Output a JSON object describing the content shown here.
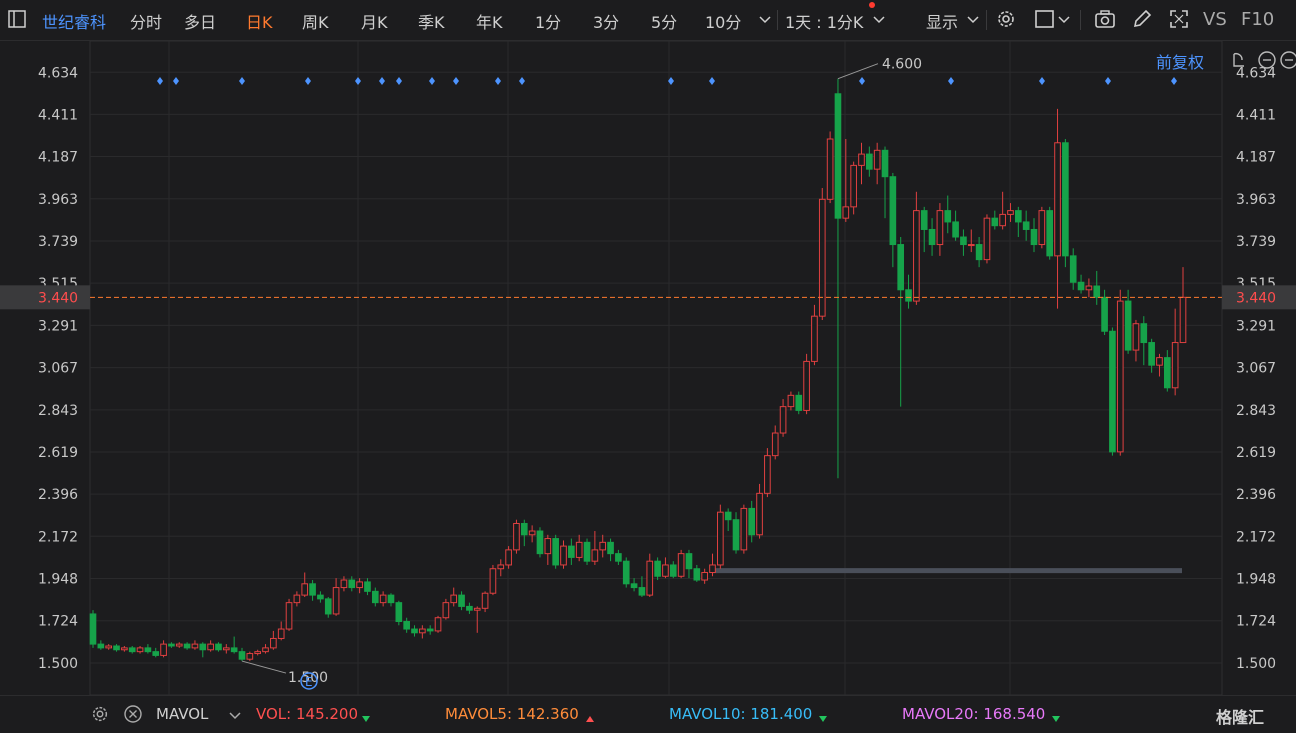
{
  "toolbar": {
    "stock_name": "世纪睿科",
    "tabs": [
      "分时",
      "多日",
      "日K",
      "周K",
      "月K",
      "季K",
      "年K",
      "1分",
      "3分",
      "5分",
      "10分"
    ],
    "active_tab": "日K",
    "interval_select": "1天 : 1分K",
    "display_label": "显示",
    "vs_label": "VS",
    "f10_label": "F10"
  },
  "adjust_label": "前复权",
  "watermark": "格隆汇",
  "bottom": {
    "indicator": "MAVOL",
    "vol": "VOL: 145.200",
    "mavol5": "MAVOL5: 142.360",
    "mavol10": "MAVOL10: 181.400",
    "mavol20": "MAVOL20: 168.540"
  },
  "colors": {
    "up": "#e04040",
    "down": "#16a34a",
    "accent": "#ff7a2f",
    "link": "#4d94ff"
  },
  "chart_data": {
    "type": "candlestick",
    "y_ticks": [
      "4.634",
      "4.411",
      "4.187",
      "3.963",
      "3.739",
      "3.515",
      "3.291",
      "3.067",
      "2.843",
      "2.619",
      "2.396",
      "2.172",
      "1.948",
      "1.724",
      "1.500"
    ],
    "ylim": [
      1.33,
      4.8
    ],
    "current_price": "3.440",
    "high_label": "4.600",
    "low_label": "1.500",
    "event_marker": "E",
    "candles": [
      [
        1.76,
        1.6,
        1.78,
        1.58
      ],
      [
        1.6,
        1.58,
        1.62,
        1.57
      ],
      [
        1.58,
        1.59,
        1.6,
        1.57
      ],
      [
        1.59,
        1.57,
        1.6,
        1.56
      ],
      [
        1.57,
        1.58,
        1.59,
        1.56
      ],
      [
        1.58,
        1.56,
        1.59,
        1.55
      ],
      [
        1.56,
        1.58,
        1.59,
        1.55
      ],
      [
        1.58,
        1.56,
        1.6,
        1.55
      ],
      [
        1.56,
        1.54,
        1.58,
        1.53
      ],
      [
        1.54,
        1.6,
        1.62,
        1.53
      ],
      [
        1.6,
        1.59,
        1.61,
        1.58
      ],
      [
        1.59,
        1.6,
        1.61,
        1.58
      ],
      [
        1.6,
        1.58,
        1.61,
        1.57
      ],
      [
        1.58,
        1.6,
        1.62,
        1.57
      ],
      [
        1.6,
        1.57,
        1.61,
        1.53
      ],
      [
        1.57,
        1.6,
        1.62,
        1.56
      ],
      [
        1.6,
        1.57,
        1.61,
        1.56
      ],
      [
        1.57,
        1.58,
        1.6,
        1.55
      ],
      [
        1.58,
        1.56,
        1.64,
        1.55
      ],
      [
        1.56,
        1.52,
        1.58,
        1.51
      ],
      [
        1.52,
        1.55,
        1.56,
        1.51
      ],
      [
        1.55,
        1.56,
        1.57,
        1.54
      ],
      [
        1.56,
        1.58,
        1.6,
        1.55
      ],
      [
        1.58,
        1.63,
        1.67,
        1.57
      ],
      [
        1.63,
        1.68,
        1.72,
        1.62
      ],
      [
        1.68,
        1.82,
        1.84,
        1.67
      ],
      [
        1.82,
        1.86,
        1.88,
        1.8
      ],
      [
        1.86,
        1.92,
        1.98,
        1.85
      ],
      [
        1.92,
        1.86,
        1.94,
        1.83
      ],
      [
        1.86,
        1.84,
        1.88,
        1.82
      ],
      [
        1.84,
        1.76,
        1.85,
        1.74
      ],
      [
        1.76,
        1.9,
        1.95,
        1.75
      ],
      [
        1.9,
        1.94,
        1.96,
        1.88
      ],
      [
        1.94,
        1.9,
        1.96,
        1.88
      ],
      [
        1.9,
        1.93,
        1.95,
        1.87
      ],
      [
        1.93,
        1.88,
        1.95,
        1.86
      ],
      [
        1.88,
        1.82,
        1.9,
        1.8
      ],
      [
        1.82,
        1.86,
        1.88,
        1.8
      ],
      [
        1.86,
        1.82,
        1.87,
        1.8
      ],
      [
        1.82,
        1.72,
        1.83,
        1.7
      ],
      [
        1.72,
        1.68,
        1.74,
        1.66
      ],
      [
        1.68,
        1.66,
        1.7,
        1.64
      ],
      [
        1.66,
        1.68,
        1.7,
        1.63
      ],
      [
        1.68,
        1.67,
        1.7,
        1.65
      ],
      [
        1.67,
        1.74,
        1.75,
        1.66
      ],
      [
        1.74,
        1.82,
        1.84,
        1.73
      ],
      [
        1.82,
        1.86,
        1.9,
        1.8
      ],
      [
        1.86,
        1.8,
        1.88,
        1.78
      ],
      [
        1.8,
        1.78,
        1.82,
        1.76
      ],
      [
        1.78,
        1.79,
        1.8,
        1.66
      ],
      [
        1.79,
        1.87,
        1.88,
        1.77
      ],
      [
        1.87,
        2.0,
        2.02,
        1.86
      ],
      [
        2.0,
        2.02,
        2.05,
        1.96
      ],
      [
        2.02,
        2.1,
        2.12,
        2.0
      ],
      [
        2.1,
        2.24,
        2.26,
        2.08
      ],
      [
        2.24,
        2.18,
        2.26,
        2.12
      ],
      [
        2.18,
        2.2,
        2.23,
        2.14
      ],
      [
        2.2,
        2.08,
        2.22,
        2.06
      ],
      [
        2.08,
        2.16,
        2.18,
        2.02
      ],
      [
        2.16,
        2.02,
        2.18,
        2.0
      ],
      [
        2.02,
        2.12,
        2.15,
        2.0
      ],
      [
        2.12,
        2.06,
        2.16,
        2.02
      ],
      [
        2.06,
        2.14,
        2.18,
        2.04
      ],
      [
        2.14,
        2.04,
        2.16,
        2.02
      ],
      [
        2.04,
        2.1,
        2.2,
        2.02
      ],
      [
        2.1,
        2.14,
        2.18,
        2.06
      ],
      [
        2.14,
        2.08,
        2.16,
        2.04
      ],
      [
        2.08,
        2.04,
        2.1,
        2.02
      ],
      [
        2.04,
        1.92,
        2.06,
        1.9
      ],
      [
        1.92,
        1.9,
        1.95,
        1.88
      ],
      [
        1.9,
        1.86,
        1.96,
        1.85
      ],
      [
        1.86,
        2.04,
        2.08,
        1.85
      ],
      [
        2.04,
        1.96,
        2.06,
        1.94
      ],
      [
        1.96,
        2.02,
        2.06,
        1.95
      ],
      [
        2.02,
        1.96,
        2.04,
        1.95
      ],
      [
        1.96,
        2.08,
        2.1,
        1.95
      ],
      [
        2.08,
        2.0,
        2.1,
        1.95
      ],
      [
        2.0,
        1.94,
        2.02,
        1.93
      ],
      [
        1.94,
        1.98,
        2.0,
        1.92
      ],
      [
        1.98,
        2.02,
        2.08,
        1.96
      ],
      [
        2.02,
        2.3,
        2.34,
        2.0
      ],
      [
        2.3,
        2.26,
        2.32,
        2.2
      ],
      [
        2.26,
        2.1,
        2.3,
        2.08
      ],
      [
        2.1,
        2.32,
        2.34,
        2.08
      ],
      [
        2.32,
        2.18,
        2.36,
        2.14
      ],
      [
        2.18,
        2.4,
        2.45,
        2.16
      ],
      [
        2.4,
        2.6,
        2.64,
        2.38
      ],
      [
        2.6,
        2.72,
        2.76,
        2.58
      ],
      [
        2.72,
        2.86,
        2.9,
        2.7
      ],
      [
        2.86,
        2.92,
        2.94,
        2.84
      ],
      [
        2.92,
        2.84,
        2.94,
        2.82
      ],
      [
        2.84,
        3.1,
        3.14,
        2.82
      ],
      [
        3.1,
        3.34,
        3.4,
        3.08
      ],
      [
        3.34,
        3.96,
        4.02,
        3.32
      ],
      [
        3.96,
        4.28,
        4.32,
        3.94
      ],
      [
        4.52,
        3.86,
        4.6,
        2.48
      ],
      [
        3.86,
        3.92,
        4.28,
        3.84
      ],
      [
        3.92,
        4.14,
        4.16,
        3.88
      ],
      [
        4.14,
        4.2,
        4.26,
        4.04
      ],
      [
        4.2,
        4.12,
        4.24,
        4.08
      ],
      [
        4.12,
        4.22,
        4.26,
        4.04
      ],
      [
        4.22,
        4.08,
        4.24,
        3.86
      ],
      [
        4.08,
        3.72,
        4.1,
        3.6
      ],
      [
        3.72,
        3.48,
        3.76,
        2.86
      ],
      [
        3.48,
        3.42,
        3.56,
        3.38
      ],
      [
        3.42,
        3.9,
        4.0,
        3.4
      ],
      [
        3.9,
        3.8,
        3.92,
        3.68
      ],
      [
        3.8,
        3.72,
        3.86,
        3.66
      ],
      [
        3.72,
        3.9,
        3.94,
        3.66
      ],
      [
        3.9,
        3.84,
        3.98,
        3.78
      ],
      [
        3.84,
        3.76,
        3.9,
        3.74
      ],
      [
        3.76,
        3.72,
        3.8,
        3.66
      ],
      [
        3.72,
        3.72,
        3.8,
        3.68
      ],
      [
        3.72,
        3.64,
        3.76,
        3.6
      ],
      [
        3.64,
        3.86,
        3.88,
        3.62
      ],
      [
        3.86,
        3.82,
        3.9,
        3.8
      ],
      [
        3.82,
        3.88,
        4.0,
        3.8
      ],
      [
        3.88,
        3.9,
        3.94,
        3.84
      ],
      [
        3.9,
        3.84,
        3.92,
        3.76
      ],
      [
        3.84,
        3.8,
        3.9,
        3.74
      ],
      [
        3.8,
        3.72,
        3.86,
        3.68
      ],
      [
        3.72,
        3.9,
        3.92,
        3.7
      ],
      [
        3.9,
        3.66,
        3.92,
        3.64
      ],
      [
        3.66,
        4.26,
        4.44,
        3.38
      ],
      [
        4.26,
        3.66,
        4.28,
        3.6
      ],
      [
        3.66,
        3.52,
        3.7,
        3.48
      ],
      [
        3.52,
        3.48,
        3.56,
        3.46
      ],
      [
        3.48,
        3.5,
        3.54,
        3.44
      ],
      [
        3.5,
        3.44,
        3.58,
        3.4
      ],
      [
        3.44,
        3.26,
        3.48,
        3.24
      ],
      [
        3.26,
        2.62,
        3.28,
        2.6
      ],
      [
        2.62,
        3.42,
        3.48,
        2.6
      ],
      [
        3.42,
        3.16,
        3.48,
        3.14
      ],
      [
        3.16,
        3.3,
        3.32,
        3.1
      ],
      [
        3.3,
        3.2,
        3.34,
        3.08
      ],
      [
        3.2,
        3.08,
        3.22,
        3.04
      ],
      [
        3.08,
        3.12,
        3.14,
        3.02
      ],
      [
        3.12,
        2.96,
        3.16,
        2.94
      ],
      [
        2.96,
        3.2,
        3.38,
        2.92
      ],
      [
        3.2,
        3.44,
        3.6,
        3.38
      ]
    ]
  }
}
